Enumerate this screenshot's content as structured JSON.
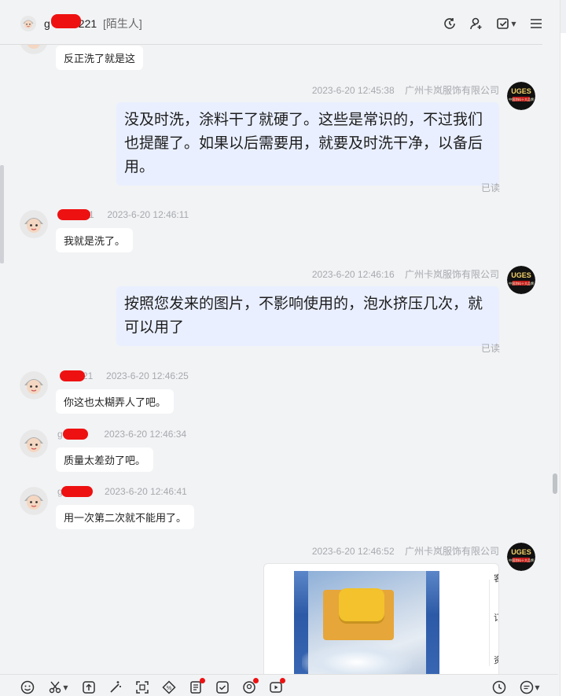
{
  "header": {
    "name": "g",
    "name_suffix": "221",
    "tag": "[陌生人]"
  },
  "messages": [
    {
      "side": "left",
      "text": "反正洗了就是这"
    },
    {
      "side": "right",
      "time": "2023-6-20 12:45:38",
      "sender": "广州卡岚服饰有限公司",
      "text": "没及时洗，涂料干了就硬了。这些是常识的，不过我们也提醒了。如果以后需要用，就要及时洗干净，以备后用。",
      "read": "已读"
    },
    {
      "side": "left",
      "name": "1",
      "time": "2023-6-20 12:46:11",
      "text": "我就是洗了。"
    },
    {
      "side": "right",
      "time": "2023-6-20 12:46:16",
      "sender": "广州卡岚服饰有限公司",
      "text": "按照您发来的图片，不影响使用的，泡水挤压几次，就可以用了",
      "read": "已读"
    },
    {
      "side": "left",
      "name": "21",
      "time": "2023-6-20 12:46:25",
      "text": "你这也太糊弄人了吧。"
    },
    {
      "side": "left",
      "name": "g  21",
      "time": "2023-6-20 12:46:34",
      "text": "质量太差劲了吧。"
    },
    {
      "side": "left",
      "name": "g   1",
      "time": "2023-6-20 12:46:41",
      "text": "用一次第二次就不能用了。"
    },
    {
      "side": "right",
      "time": "2023-6-20 12:46:52",
      "sender": "广州卡岚服饰有限公司",
      "card_chars": [
        "客",
        "订",
        "资"
      ]
    }
  ],
  "logo": {
    "top_text": "UGES",
    "lines": [
      "中国涂料十大品牌"
    ]
  },
  "toolbar": {
    "left_icons": [
      "emoji-icon",
      "scissors-icon",
      "upload-icon",
      "magic-icon",
      "screenshot-icon",
      "coupon-icon",
      "order-icon",
      "check-icon",
      "profile-icon",
      "video-icon"
    ],
    "right_icons": [
      "history-icon",
      "quick-reply-icon"
    ]
  },
  "colors": {
    "accent_bubble": "#e9efff",
    "badge": "#ee1111"
  }
}
